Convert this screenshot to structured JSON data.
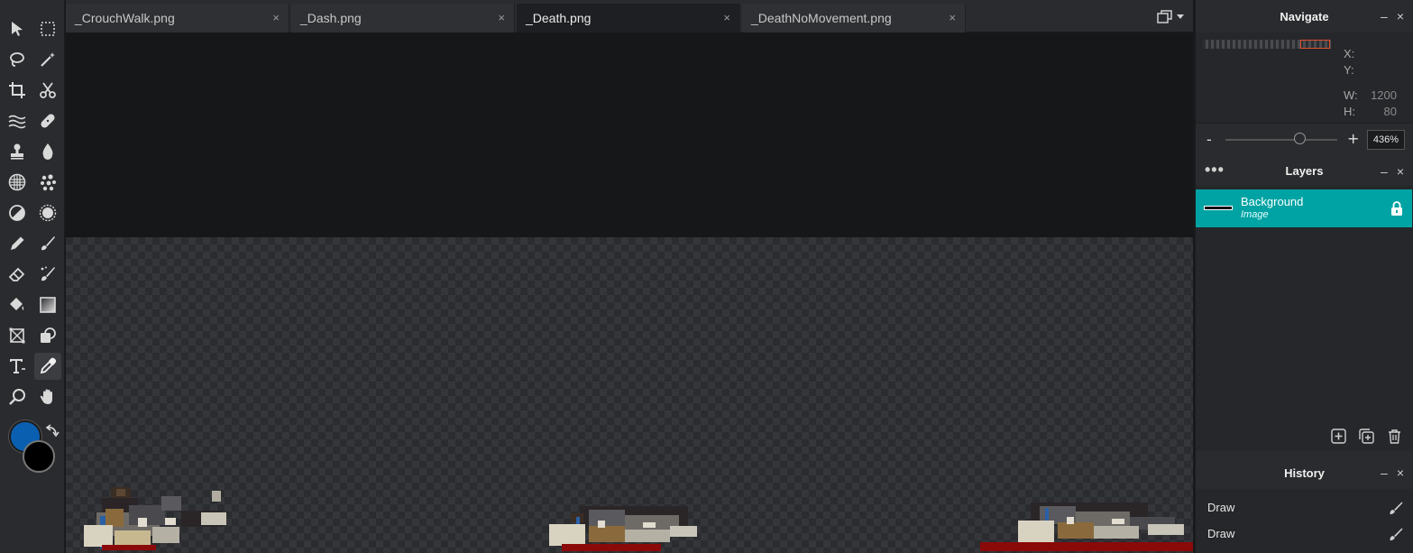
{
  "toolbar": {
    "tools": [
      "move-icon",
      "marquee-icon",
      "lasso-icon",
      "magic-wand-icon",
      "crop-icon",
      "cut-icon",
      "liquify-icon",
      "heal-icon",
      "clone-stamp-icon",
      "blur-icon",
      "sponge-icon",
      "dots-icon",
      "dodge-icon",
      "burn-icon",
      "pencil-icon",
      "brush-icon",
      "eraser-icon",
      "smart-brush-icon",
      "paint-bucket-icon",
      "gradient-icon",
      "transform-icon",
      "shape-icon",
      "text-icon",
      "eyedropper-icon",
      "zoom-icon",
      "hand-icon"
    ],
    "active_tool": "eyedropper-icon",
    "foreground_color": "#0b5fb0",
    "background_color": "#000000"
  },
  "tabs": [
    {
      "label": "_CrouchWalk.png",
      "close": "×"
    },
    {
      "label": "_Dash.png",
      "close": "×"
    },
    {
      "label": "_Death.png",
      "close": "×"
    },
    {
      "label": "_DeathNoMovement.png",
      "close": "×"
    }
  ],
  "active_tab": "_Death.png",
  "navigate": {
    "title": "Navigate",
    "x_label": "X:",
    "y_label": "Y:",
    "x_value": "",
    "y_value": "",
    "w_label": "W:",
    "h_label": "H:",
    "w_value": "1200",
    "h_value": "80",
    "zoom_minus": "-",
    "zoom_plus": "+",
    "zoom_value": "436%",
    "zoom_fraction": 0.66,
    "minimize": "–",
    "close": "×"
  },
  "layers": {
    "title": "Layers",
    "menu": "•••",
    "minimize": "–",
    "close": "×",
    "items": [
      {
        "name": "Background",
        "type": "Image",
        "locked": true
      }
    ],
    "selected_color": "#00a3a3"
  },
  "history": {
    "title": "History",
    "minimize": "–",
    "close": "×",
    "items": [
      {
        "label": "Draw"
      },
      {
        "label": "Draw"
      }
    ]
  }
}
